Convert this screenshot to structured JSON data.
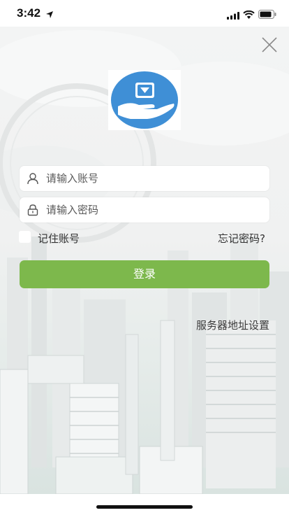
{
  "status_bar": {
    "time": "3:42"
  },
  "login": {
    "account_placeholder": "请输入账号",
    "password_placeholder": "请输入密码",
    "remember_label": "记住账号",
    "forgot_label": "忘记密码?",
    "login_button_label": "登录",
    "server_settings_label": "服务器地址设置"
  },
  "icons": {
    "close": "close-icon",
    "user": "user-icon",
    "lock": "lock-icon",
    "logo": "app-logo"
  },
  "colors": {
    "accent_green": "#7db84c",
    "logo_blue": "#3f8fd6"
  }
}
